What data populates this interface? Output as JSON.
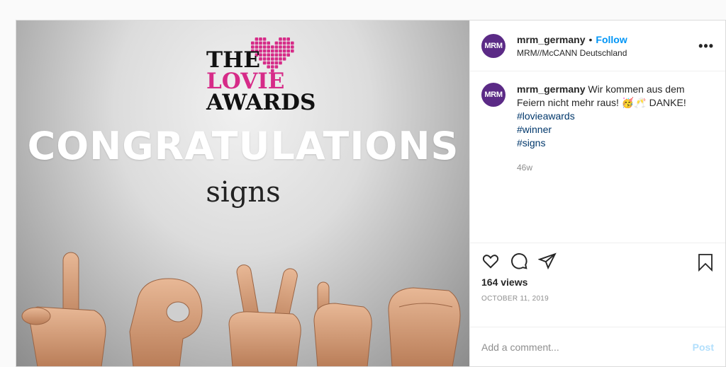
{
  "media": {
    "logo_the": "THE",
    "logo_lovie": "LOVIE",
    "logo_awards": "AWARDS",
    "headline": "CONGRATULATIONS",
    "subline": "signs"
  },
  "header": {
    "avatar_text": "MRM",
    "username": "mrm_germany",
    "separator": "•",
    "follow_label": "Follow",
    "subtitle": "MRM//McCANN Deutschland",
    "more_label": "•••"
  },
  "caption": {
    "avatar_text": "MRM",
    "username": "mrm_germany",
    "text": "Wir kommen aus dem Feiern nicht mehr raus! 🥳🥂 DANKE!",
    "hashtags": [
      "#lovieawards",
      "#winner",
      "#signs"
    ],
    "time": "46w"
  },
  "stats": {
    "views": "164 views",
    "date": "OCTOBER 11, 2019"
  },
  "comment_box": {
    "placeholder": "Add a comment...",
    "post_label": "Post"
  },
  "colors": {
    "brand_purple": "#5b2a86",
    "link_blue": "#0095f6",
    "hashtag_blue": "#00376b",
    "lovie_pink": "#d62b88"
  }
}
